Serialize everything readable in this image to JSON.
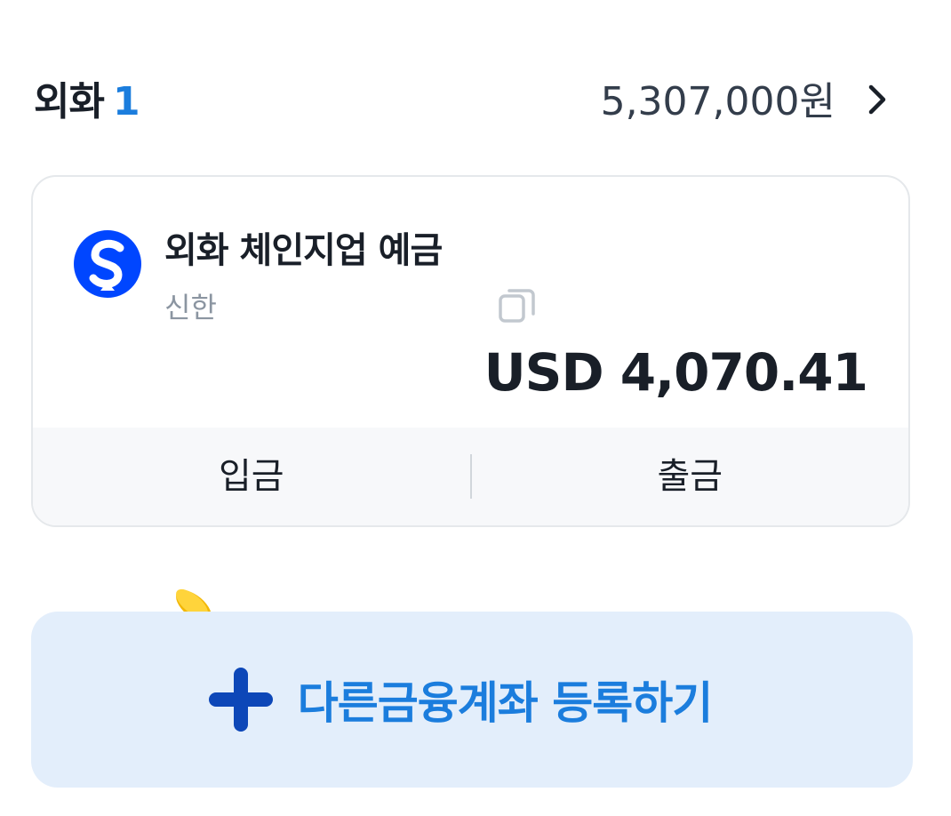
{
  "header": {
    "title": "외화",
    "count": "1",
    "total": "5,307,000원",
    "chevron_icon": "chevron-right-icon"
  },
  "account": {
    "name": "외화 체인지업 예금",
    "bank": "신한",
    "bank_logo_icon": "shinhan-logo-icon",
    "copy_icon": "copy-icon",
    "balance": "USD 4,070.41",
    "deposit_label": "입금",
    "withdraw_label": "출금",
    "brand_color": "#0046ff"
  },
  "register": {
    "label": "다른금융계좌 등록하기",
    "icon": "plus-icon",
    "decoration_icon": "coins-icon",
    "accent_color": "#1b7ddd",
    "background_color": "#e3eefb"
  }
}
